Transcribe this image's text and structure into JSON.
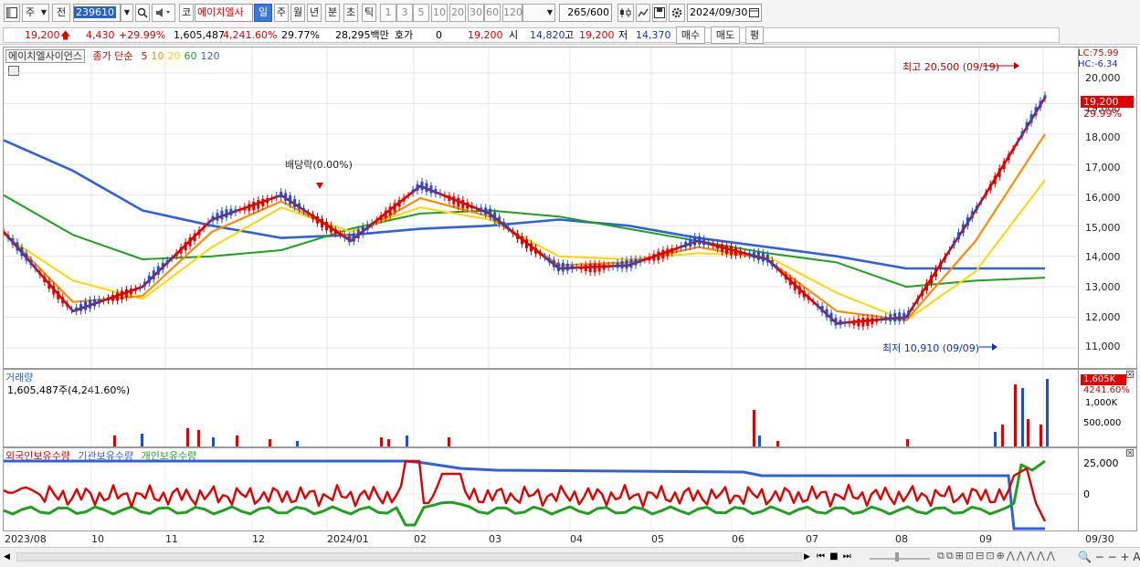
{
  "toolbar": {
    "market_button": "주",
    "view_button": "전",
    "code": "239610",
    "market_label": "코",
    "stock_name": "에이치엘사",
    "periods": [
      "일",
      "주",
      "월",
      "년",
      "분",
      "초",
      "틱"
    ],
    "active_period": "일",
    "intervals": [
      "1",
      "3",
      "5",
      "10",
      "20",
      "30",
      "60",
      "120"
    ],
    "count": "265",
    "count_total": "/600",
    "date": "2024/09/30"
  },
  "quote": {
    "price": "19,200",
    "change": "4,430",
    "change_pct": "+29.99%",
    "volume": "1,605,487",
    "volume_pct": "4,241.60%",
    "turnover": "29.77%",
    "amount": "28,295백만",
    "hoga_label": "호가",
    "hoga_value": "0",
    "hoga_price": "19,200",
    "open_label": "시",
    "open": "14,820",
    "high_label": "고",
    "high": "19,200",
    "low_label": "저",
    "low": "14,370",
    "buy_label": "매수",
    "sell_label": "매도",
    "eval_label": "평"
  },
  "legend": {
    "name": "에이치엘사이언스",
    "ma_title": "종가 단순",
    "ma": [
      "5",
      "10",
      "20",
      "60",
      "120"
    ],
    "ma_colors": [
      "#e00000",
      "#ff8c00",
      "#ffd700",
      "#20a020",
      "#3060e0"
    ]
  },
  "annotations": {
    "high": "최고 20,500 (09/19)",
    "low": "최저 10,910 (09/09)",
    "dividend": "배당락(0.00%)",
    "lc": "LC:75.99",
    "hc": "HC:-6.34",
    "last_price": "19,200",
    "last_pct": "29.99%"
  },
  "volume_panel": {
    "title": "거래량",
    "value": "1,605,487주(4,241.60%)",
    "last": "1,605K",
    "last_pct": "4241.60%"
  },
  "holdings_panel": {
    "labels": [
      "외국인보유수량",
      "기관보유수량",
      "개인보유수량"
    ],
    "colors": [
      "#e00000",
      "#3060e0",
      "#20a020"
    ]
  },
  "x_labels": [
    "2023/08",
    "10",
    "11",
    "12",
    "2024/01",
    "02",
    "03",
    "04",
    "05",
    "06",
    "07",
    "08",
    "09",
    "09/30"
  ],
  "price_ticks": [
    "20,000",
    "19,000",
    "18,000",
    "17,000",
    "16,000",
    "15,000",
    "14,000",
    "13,000",
    "12,000",
    "11,000"
  ],
  "volume_ticks": [
    "1,000K",
    "500,000"
  ],
  "holdings_ticks": [
    "25,000",
    "0"
  ],
  "chart_data": {
    "type": "line",
    "title": "에이치엘사이언스",
    "x": [
      "2023/08",
      "10",
      "11",
      "12",
      "2024/01",
      "02",
      "03",
      "04",
      "05",
      "06",
      "07",
      "08",
      "09",
      "09/30"
    ],
    "series": [
      {
        "name": "5",
        "values": [
          14800,
          12200,
          13000,
          15200,
          16000,
          14500,
          16300,
          15400,
          13600,
          13700,
          14500,
          13900,
          11800,
          12000,
          15500,
          19200
        ]
      },
      {
        "name": "10",
        "values": [
          14800,
          12500,
          12700,
          14800,
          15800,
          14600,
          15900,
          15300,
          13700,
          13800,
          14300,
          13900,
          12200,
          11900,
          14500,
          18000
        ]
      },
      {
        "name": "20",
        "values": [
          14700,
          13200,
          12600,
          14300,
          15600,
          14800,
          15600,
          15200,
          14000,
          13900,
          14100,
          14000,
          12800,
          11900,
          13500,
          16500
        ]
      },
      {
        "name": "60",
        "values": [
          16000,
          14700,
          13900,
          14000,
          14200,
          14900,
          15400,
          15500,
          15300,
          14900,
          14500,
          14100,
          13800,
          13000,
          13200,
          13300
        ]
      },
      {
        "name": "120",
        "values": [
          17800,
          16800,
          15500,
          15000,
          14600,
          14700,
          14900,
          15000,
          15200,
          15000,
          14600,
          14300,
          14000,
          13600,
          13600,
          13600
        ]
      }
    ],
    "price_range": [
      10700,
      20600
    ],
    "high": {
      "value": 20500,
      "date": "09/19"
    },
    "low": {
      "value": 10910,
      "date": "09/09"
    },
    "last_price": 19200
  }
}
